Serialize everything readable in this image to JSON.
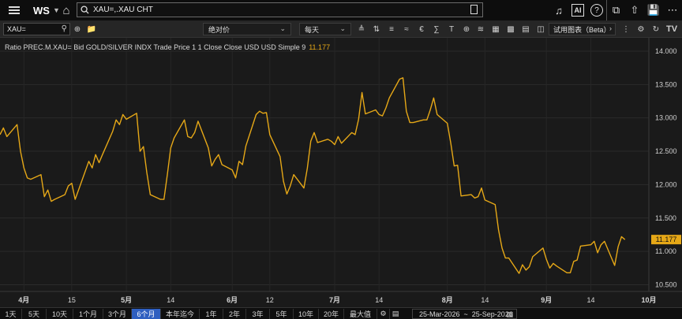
{
  "topbar": {
    "app_name": "WS",
    "command_text": "XAU=,.XAU CHT"
  },
  "toolbar": {
    "ric_value": "XAU=",
    "price_type": "绝对价",
    "interval": "每天",
    "chart_mode": "试用图表（Beta）"
  },
  "legend": {
    "text": "Ratio PREC.M.XAU= Bid GOLD/SILVER INDX Trade Price 1 1 Close Close USD USD Simple 9",
    "last_value": "11.177"
  },
  "periods": [
    {
      "label": "1天"
    },
    {
      "label": "5天"
    },
    {
      "label": "10天"
    },
    {
      "label": "1个月"
    },
    {
      "label": "3个月"
    },
    {
      "label": "6个月",
      "active": true
    },
    {
      "label": "本年迄今"
    },
    {
      "label": "1年"
    },
    {
      "label": "2年"
    },
    {
      "label": "3年"
    },
    {
      "label": "5年"
    },
    {
      "label": "10年"
    },
    {
      "label": "20年"
    },
    {
      "label": "最大值"
    }
  ],
  "date_range": "25-Mar-2026  ~  25-Sep-2026",
  "colors": {
    "line": "#e6a817",
    "bg": "#1a1a1a",
    "active": "#2f5fc0"
  },
  "chart_data": {
    "type": "line",
    "series_color": "#e6a817",
    "ylim": [
      10.4,
      14.2
    ],
    "y_ticks": [
      "10.500",
      "11.000",
      "11.500",
      "12.000",
      "12.500",
      "13.000",
      "13.500",
      "14.000"
    ],
    "x_ticks": [
      {
        "label": "4月",
        "bold": true,
        "date": "2026-04-01"
      },
      {
        "label": "15",
        "bold": false,
        "date": "2026-04-15"
      },
      {
        "label": "5月",
        "bold": true,
        "date": "2026-05-01"
      },
      {
        "label": "14",
        "bold": false,
        "date": "2026-05-14"
      },
      {
        "label": "6月",
        "bold": true,
        "date": "2026-06-01"
      },
      {
        "label": "12",
        "bold": false,
        "date": "2026-06-12"
      },
      {
        "label": "7月",
        "bold": true,
        "date": "2026-07-01"
      },
      {
        "label": "14",
        "bold": false,
        "date": "2026-07-14"
      },
      {
        "label": "8月",
        "bold": true,
        "date": "2026-08-03"
      },
      {
        "label": "14",
        "bold": false,
        "date": "2026-08-14"
      },
      {
        "label": "9月",
        "bold": true,
        "date": "2026-09-01"
      },
      {
        "label": "14",
        "bold": false,
        "date": "2026-09-14"
      },
      {
        "label": "10月",
        "bold": true,
        "date": "2026-10-01"
      }
    ],
    "x_range": [
      "2026-03-25",
      "2026-10-01"
    ],
    "last_value": 11.177,
    "points": [
      {
        "x": "2026-03-25",
        "y": 12.75
      },
      {
        "x": "2026-03-26",
        "y": 12.85
      },
      {
        "x": "2026-03-27",
        "y": 12.72
      },
      {
        "x": "2026-03-30",
        "y": 12.9
      },
      {
        "x": "2026-03-31",
        "y": 12.5
      },
      {
        "x": "2026-04-01",
        "y": 12.25
      },
      {
        "x": "2026-04-02",
        "y": 12.1
      },
      {
        "x": "2026-04-03",
        "y": 12.08
      },
      {
        "x": "2026-04-06",
        "y": 12.15
      },
      {
        "x": "2026-04-07",
        "y": 11.82
      },
      {
        "x": "2026-04-08",
        "y": 11.92
      },
      {
        "x": "2026-04-09",
        "y": 11.75
      },
      {
        "x": "2026-04-10",
        "y": 11.78
      },
      {
        "x": "2026-04-13",
        "y": 11.85
      },
      {
        "x": "2026-04-14",
        "y": 11.98
      },
      {
        "x": "2026-04-15",
        "y": 12.02
      },
      {
        "x": "2026-04-16",
        "y": 11.78
      },
      {
        "x": "2026-04-17",
        "y": 11.92
      },
      {
        "x": "2026-04-20",
        "y": 12.35
      },
      {
        "x": "2026-04-21",
        "y": 12.25
      },
      {
        "x": "2026-04-22",
        "y": 12.45
      },
      {
        "x": "2026-04-23",
        "y": 12.33
      },
      {
        "x": "2026-04-24",
        "y": 12.45
      },
      {
        "x": "2026-04-27",
        "y": 12.8
      },
      {
        "x": "2026-04-28",
        "y": 12.97
      },
      {
        "x": "2026-04-29",
        "y": 12.9
      },
      {
        "x": "2026-04-30",
        "y": 13.05
      },
      {
        "x": "2026-05-01",
        "y": 12.98
      },
      {
        "x": "2026-05-04",
        "y": 13.07
      },
      {
        "x": "2026-05-05",
        "y": 12.5
      },
      {
        "x": "2026-05-06",
        "y": 12.57
      },
      {
        "x": "2026-05-07",
        "y": 12.18
      },
      {
        "x": "2026-05-08",
        "y": 11.85
      },
      {
        "x": "2026-05-11",
        "y": 11.78
      },
      {
        "x": "2026-05-12",
        "y": 11.78
      },
      {
        "x": "2026-05-13",
        "y": 12.15
      },
      {
        "x": "2026-05-14",
        "y": 12.55
      },
      {
        "x": "2026-05-15",
        "y": 12.7
      },
      {
        "x": "2026-05-18",
        "y": 12.97
      },
      {
        "x": "2026-05-19",
        "y": 12.72
      },
      {
        "x": "2026-05-20",
        "y": 12.7
      },
      {
        "x": "2026-05-21",
        "y": 12.78
      },
      {
        "x": "2026-05-22",
        "y": 12.95
      },
      {
        "x": "2026-05-25",
        "y": 12.55
      },
      {
        "x": "2026-05-26",
        "y": 12.28
      },
      {
        "x": "2026-05-27",
        "y": 12.38
      },
      {
        "x": "2026-05-28",
        "y": 12.45
      },
      {
        "x": "2026-05-29",
        "y": 12.3
      },
      {
        "x": "2026-06-01",
        "y": 12.22
      },
      {
        "x": "2026-06-02",
        "y": 12.1
      },
      {
        "x": "2026-06-03",
        "y": 12.35
      },
      {
        "x": "2026-06-04",
        "y": 12.3
      },
      {
        "x": "2026-06-05",
        "y": 12.58
      },
      {
        "x": "2026-06-08",
        "y": 13.05
      },
      {
        "x": "2026-06-09",
        "y": 13.1
      },
      {
        "x": "2026-06-10",
        "y": 13.07
      },
      {
        "x": "2026-06-11",
        "y": 13.08
      },
      {
        "x": "2026-06-12",
        "y": 12.75
      },
      {
        "x": "2026-06-15",
        "y": 12.42
      },
      {
        "x": "2026-06-16",
        "y": 12.05
      },
      {
        "x": "2026-06-17",
        "y": 11.86
      },
      {
        "x": "2026-06-18",
        "y": 11.98
      },
      {
        "x": "2026-06-19",
        "y": 12.15
      },
      {
        "x": "2026-06-22",
        "y": 11.95
      },
      {
        "x": "2026-06-23",
        "y": 12.25
      },
      {
        "x": "2026-06-24",
        "y": 12.65
      },
      {
        "x": "2026-06-25",
        "y": 12.78
      },
      {
        "x": "2026-06-26",
        "y": 12.63
      },
      {
        "x": "2026-06-29",
        "y": 12.68
      },
      {
        "x": "2026-06-30",
        "y": 12.65
      },
      {
        "x": "2026-07-01",
        "y": 12.6
      },
      {
        "x": "2026-07-02",
        "y": 12.72
      },
      {
        "x": "2026-07-03",
        "y": 12.62
      },
      {
        "x": "2026-07-06",
        "y": 12.78
      },
      {
        "x": "2026-07-07",
        "y": 12.75
      },
      {
        "x": "2026-07-08",
        "y": 12.98
      },
      {
        "x": "2026-07-09",
        "y": 13.38
      },
      {
        "x": "2026-07-10",
        "y": 13.06
      },
      {
        "x": "2026-07-13",
        "y": 13.12
      },
      {
        "x": "2026-07-14",
        "y": 13.05
      },
      {
        "x": "2026-07-15",
        "y": 13.03
      },
      {
        "x": "2026-07-16",
        "y": 13.15
      },
      {
        "x": "2026-07-17",
        "y": 13.3
      },
      {
        "x": "2026-07-20",
        "y": 13.58
      },
      {
        "x": "2026-07-21",
        "y": 13.6
      },
      {
        "x": "2026-07-22",
        "y": 13.1
      },
      {
        "x": "2026-07-23",
        "y": 12.93
      },
      {
        "x": "2026-07-24",
        "y": 12.93
      },
      {
        "x": "2026-07-27",
        "y": 12.97
      },
      {
        "x": "2026-07-28",
        "y": 12.97
      },
      {
        "x": "2026-07-29",
        "y": 13.12
      },
      {
        "x": "2026-07-30",
        "y": 13.3
      },
      {
        "x": "2026-07-31",
        "y": 13.05
      },
      {
        "x": "2026-08-03",
        "y": 12.92
      },
      {
        "x": "2026-08-04",
        "y": 12.62
      },
      {
        "x": "2026-08-05",
        "y": 12.28
      },
      {
        "x": "2026-08-06",
        "y": 12.29
      },
      {
        "x": "2026-08-07",
        "y": 11.83
      },
      {
        "x": "2026-08-10",
        "y": 11.85
      },
      {
        "x": "2026-08-11",
        "y": 11.8
      },
      {
        "x": "2026-08-12",
        "y": 11.82
      },
      {
        "x": "2026-08-13",
        "y": 11.95
      },
      {
        "x": "2026-08-14",
        "y": 11.77
      },
      {
        "x": "2026-08-17",
        "y": 11.7
      },
      {
        "x": "2026-08-18",
        "y": 11.32
      },
      {
        "x": "2026-08-19",
        "y": 11.05
      },
      {
        "x": "2026-08-20",
        "y": 10.9
      },
      {
        "x": "2026-08-21",
        "y": 10.9
      },
      {
        "x": "2026-08-24",
        "y": 10.67
      },
      {
        "x": "2026-08-25",
        "y": 10.8
      },
      {
        "x": "2026-08-26",
        "y": 10.72
      },
      {
        "x": "2026-08-27",
        "y": 10.77
      },
      {
        "x": "2026-08-28",
        "y": 10.92
      },
      {
        "x": "2026-08-31",
        "y": 11.05
      },
      {
        "x": "2026-09-01",
        "y": 10.88
      },
      {
        "x": "2026-09-02",
        "y": 10.75
      },
      {
        "x": "2026-09-03",
        "y": 10.82
      },
      {
        "x": "2026-09-04",
        "y": 10.78
      },
      {
        "x": "2026-09-07",
        "y": 10.68
      },
      {
        "x": "2026-09-08",
        "y": 10.68
      },
      {
        "x": "2026-09-09",
        "y": 10.85
      },
      {
        "x": "2026-09-10",
        "y": 10.87
      },
      {
        "x": "2026-09-11",
        "y": 11.08
      },
      {
        "x": "2026-09-14",
        "y": 11.1
      },
      {
        "x": "2026-09-15",
        "y": 11.15
      },
      {
        "x": "2026-09-16",
        "y": 10.98
      },
      {
        "x": "2026-09-17",
        "y": 11.1
      },
      {
        "x": "2026-09-18",
        "y": 11.15
      },
      {
        "x": "2026-09-21",
        "y": 10.79
      },
      {
        "x": "2026-09-22",
        "y": 11.07
      },
      {
        "x": "2026-09-23",
        "y": 11.22
      },
      {
        "x": "2026-09-24",
        "y": 11.177
      }
    ]
  }
}
